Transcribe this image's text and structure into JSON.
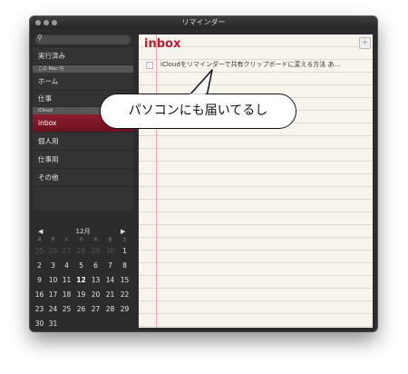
{
  "window": {
    "title": "リマインダー"
  },
  "sidebar": {
    "search_icon": "search-icon",
    "items": [
      {
        "label": "実行済み"
      },
      {
        "label": "ホーム"
      },
      {
        "label": "仕事"
      },
      {
        "label": "inbox",
        "selected": true
      },
      {
        "label": "個人用"
      },
      {
        "label": "仕事用"
      },
      {
        "label": "その他"
      }
    ],
    "groups": [
      {
        "label": "この Mac 内"
      },
      {
        "label": "iCloud"
      }
    ]
  },
  "calendar": {
    "month": "12月",
    "prev": "◀",
    "next": "▶",
    "weekdays": [
      "日",
      "月",
      "火",
      "水",
      "木",
      "金",
      "土"
    ],
    "days": [
      [
        "25",
        "26",
        "27",
        "28",
        "29",
        "30",
        "1"
      ],
      [
        "2",
        "3",
        "4",
        "5",
        "6",
        "7",
        "8"
      ],
      [
        "9",
        "10",
        "11",
        "12",
        "13",
        "14",
        "15"
      ],
      [
        "16",
        "17",
        "18",
        "19",
        "20",
        "21",
        "22"
      ],
      [
        "23",
        "24",
        "25",
        "26",
        "27",
        "28",
        "29"
      ],
      [
        "30",
        "31",
        "",
        "",
        "",
        "",
        ""
      ]
    ],
    "today": "12"
  },
  "bottombar": {
    "add_label": "+"
  },
  "main": {
    "list_title": "inbox",
    "add_label": "+",
    "reminders": [
      {
        "text": "iCloudをリマインダーで共有クリップボードに変える方法 あ…",
        "done": false
      }
    ]
  },
  "annotation": {
    "text": "パソコンにも届いてるし"
  }
}
